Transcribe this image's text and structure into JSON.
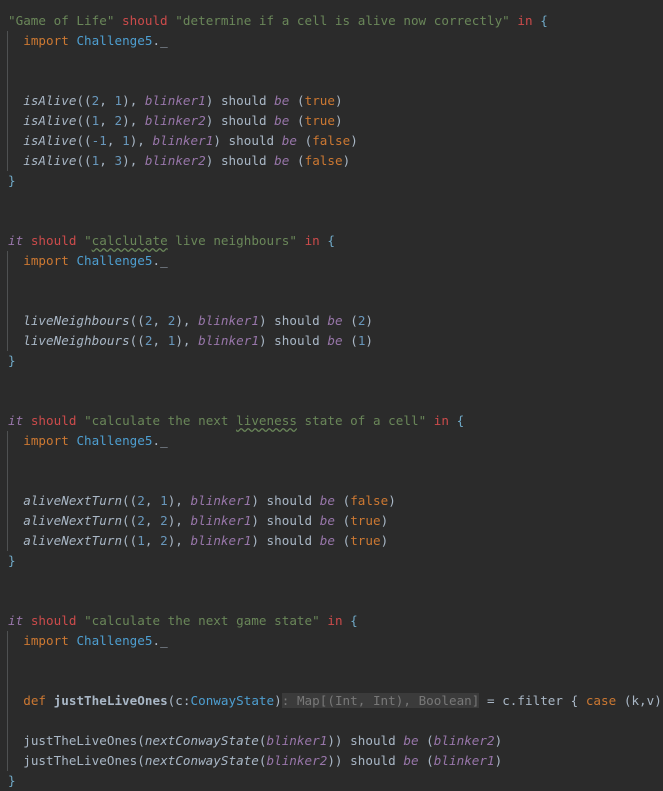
{
  "editor": {
    "language": "scala",
    "theme": "darcula",
    "background_color": "#2b2b2b",
    "default_text_color": "#a9b7c6",
    "colors": {
      "string": "#6a8759",
      "keyword_red": "#cc4b4b",
      "keyword_orange": "#cc7832",
      "identifier_purple": "#9876aa",
      "number": "#6897bb",
      "class_name": "#4e9fd1",
      "type_hint_background": "#3b3b3b",
      "type_hint_text": "#787878",
      "spellcheck_squiggle": "#6a8759",
      "indent_guide": "#4f5152"
    }
  },
  "lines": [
    {
      "id": "line-1",
      "indent": false,
      "tokens": [
        {
          "t": "\"Game of Life\"",
          "c": "str"
        },
        {
          "t": " ",
          "c": "plain"
        },
        {
          "t": "should",
          "c": "kw-red"
        },
        {
          "t": " ",
          "c": "plain"
        },
        {
          "t": "\"determine if a cell is alive now correctly\"",
          "c": "str"
        },
        {
          "t": " ",
          "c": "plain"
        },
        {
          "t": "in",
          "c": "kw-red"
        },
        {
          "t": " ",
          "c": "plain"
        },
        {
          "t": "{",
          "c": "brace-hl"
        }
      ]
    },
    {
      "id": "line-2",
      "indent": true,
      "tokens": [
        {
          "t": "  ",
          "c": "plain"
        },
        {
          "t": "import",
          "c": "kw-or"
        },
        {
          "t": " ",
          "c": "plain"
        },
        {
          "t": "Challenge5",
          "c": "cls"
        },
        {
          "t": "._",
          "c": "plain"
        }
      ]
    },
    {
      "id": "line-3",
      "indent": true,
      "tokens": []
    },
    {
      "id": "line-4",
      "indent": true,
      "tokens": []
    },
    {
      "id": "line-5",
      "indent": true,
      "tokens": [
        {
          "t": "  ",
          "c": "plain"
        },
        {
          "t": "isAlive",
          "c": "ital"
        },
        {
          "t": "((",
          "c": "plain"
        },
        {
          "t": "2",
          "c": "num"
        },
        {
          "t": ", ",
          "c": "plain"
        },
        {
          "t": "1",
          "c": "num"
        },
        {
          "t": "), ",
          "c": "plain"
        },
        {
          "t": "blinker1",
          "c": "purp"
        },
        {
          "t": ") should ",
          "c": "plain"
        },
        {
          "t": "be",
          "c": "purp"
        },
        {
          "t": " (",
          "c": "plain"
        },
        {
          "t": "true",
          "c": "kw-or"
        },
        {
          "t": ")",
          "c": "plain"
        }
      ]
    },
    {
      "id": "line-6",
      "indent": true,
      "tokens": [
        {
          "t": "  ",
          "c": "plain"
        },
        {
          "t": "isAlive",
          "c": "ital"
        },
        {
          "t": "((",
          "c": "plain"
        },
        {
          "t": "1",
          "c": "num"
        },
        {
          "t": ", ",
          "c": "plain"
        },
        {
          "t": "2",
          "c": "num"
        },
        {
          "t": "), ",
          "c": "plain"
        },
        {
          "t": "blinker2",
          "c": "purp"
        },
        {
          "t": ") should ",
          "c": "plain"
        },
        {
          "t": "be",
          "c": "purp"
        },
        {
          "t": " (",
          "c": "plain"
        },
        {
          "t": "true",
          "c": "kw-or"
        },
        {
          "t": ")",
          "c": "plain"
        }
      ]
    },
    {
      "id": "line-7",
      "indent": true,
      "tokens": [
        {
          "t": "  ",
          "c": "plain"
        },
        {
          "t": "isAlive",
          "c": "ital"
        },
        {
          "t": "((",
          "c": "plain"
        },
        {
          "t": "-1",
          "c": "num"
        },
        {
          "t": ", ",
          "c": "plain"
        },
        {
          "t": "1",
          "c": "num"
        },
        {
          "t": "), ",
          "c": "plain"
        },
        {
          "t": "blinker1",
          "c": "purp"
        },
        {
          "t": ") should ",
          "c": "plain"
        },
        {
          "t": "be",
          "c": "purp"
        },
        {
          "t": " (",
          "c": "plain"
        },
        {
          "t": "false",
          "c": "kw-or"
        },
        {
          "t": ")",
          "c": "plain"
        }
      ]
    },
    {
      "id": "line-8",
      "indent": true,
      "tokens": [
        {
          "t": "  ",
          "c": "plain"
        },
        {
          "t": "isAlive",
          "c": "ital"
        },
        {
          "t": "((",
          "c": "plain"
        },
        {
          "t": "1",
          "c": "num"
        },
        {
          "t": ", ",
          "c": "plain"
        },
        {
          "t": "3",
          "c": "num"
        },
        {
          "t": "), ",
          "c": "plain"
        },
        {
          "t": "blinker2",
          "c": "purp"
        },
        {
          "t": ") should ",
          "c": "plain"
        },
        {
          "t": "be",
          "c": "purp"
        },
        {
          "t": " (",
          "c": "plain"
        },
        {
          "t": "false",
          "c": "kw-or"
        },
        {
          "t": ")",
          "c": "plain"
        }
      ]
    },
    {
      "id": "line-9",
      "indent": false,
      "tokens": [
        {
          "t": "}",
          "c": "brace-hl"
        }
      ]
    },
    {
      "id": "line-10",
      "indent": false,
      "tokens": []
    },
    {
      "id": "line-11",
      "indent": false,
      "tokens": []
    },
    {
      "id": "line-12",
      "indent": false,
      "tokens": [
        {
          "t": "it",
          "c": "purp"
        },
        {
          "t": " ",
          "c": "plain"
        },
        {
          "t": "should",
          "c": "kw-red"
        },
        {
          "t": " ",
          "c": "plain"
        },
        {
          "t": "\"",
          "c": "str"
        },
        {
          "t": "calclulate",
          "c": "str typo"
        },
        {
          "t": " live neighbours\"",
          "c": "str"
        },
        {
          "t": " ",
          "c": "plain"
        },
        {
          "t": "in",
          "c": "kw-red"
        },
        {
          "t": " ",
          "c": "plain"
        },
        {
          "t": "{",
          "c": "brace-hl"
        }
      ]
    },
    {
      "id": "line-13",
      "indent": true,
      "tokens": [
        {
          "t": "  ",
          "c": "plain"
        },
        {
          "t": "import",
          "c": "kw-or"
        },
        {
          "t": " ",
          "c": "plain"
        },
        {
          "t": "Challenge5",
          "c": "cls"
        },
        {
          "t": "._",
          "c": "plain"
        }
      ]
    },
    {
      "id": "line-14",
      "indent": true,
      "tokens": []
    },
    {
      "id": "line-15",
      "indent": true,
      "tokens": []
    },
    {
      "id": "line-16",
      "indent": true,
      "tokens": [
        {
          "t": "  ",
          "c": "plain"
        },
        {
          "t": "liveNeighbours",
          "c": "ital"
        },
        {
          "t": "((",
          "c": "plain"
        },
        {
          "t": "2",
          "c": "num"
        },
        {
          "t": ", ",
          "c": "plain"
        },
        {
          "t": "2",
          "c": "num"
        },
        {
          "t": "), ",
          "c": "plain"
        },
        {
          "t": "blinker1",
          "c": "purp"
        },
        {
          "t": ") should ",
          "c": "plain"
        },
        {
          "t": "be",
          "c": "purp"
        },
        {
          "t": " (",
          "c": "plain"
        },
        {
          "t": "2",
          "c": "num"
        },
        {
          "t": ")",
          "c": "plain"
        }
      ]
    },
    {
      "id": "line-17",
      "indent": true,
      "tokens": [
        {
          "t": "  ",
          "c": "plain"
        },
        {
          "t": "liveNeighbours",
          "c": "ital"
        },
        {
          "t": "((",
          "c": "plain"
        },
        {
          "t": "2",
          "c": "num"
        },
        {
          "t": ", ",
          "c": "plain"
        },
        {
          "t": "1",
          "c": "num"
        },
        {
          "t": "), ",
          "c": "plain"
        },
        {
          "t": "blinker1",
          "c": "purp"
        },
        {
          "t": ") should ",
          "c": "plain"
        },
        {
          "t": "be",
          "c": "purp"
        },
        {
          "t": " (",
          "c": "plain"
        },
        {
          "t": "1",
          "c": "num"
        },
        {
          "t": ")",
          "c": "plain"
        }
      ]
    },
    {
      "id": "line-18",
      "indent": false,
      "tokens": [
        {
          "t": "}",
          "c": "brace-hl"
        }
      ]
    },
    {
      "id": "line-19",
      "indent": false,
      "tokens": []
    },
    {
      "id": "line-20",
      "indent": false,
      "tokens": []
    },
    {
      "id": "line-21",
      "indent": false,
      "tokens": [
        {
          "t": "it",
          "c": "purp"
        },
        {
          "t": " ",
          "c": "plain"
        },
        {
          "t": "should",
          "c": "kw-red"
        },
        {
          "t": " ",
          "c": "plain"
        },
        {
          "t": "\"calculate the next ",
          "c": "str"
        },
        {
          "t": "liveness",
          "c": "str typo"
        },
        {
          "t": " state of a cell\"",
          "c": "str"
        },
        {
          "t": " ",
          "c": "plain"
        },
        {
          "t": "in",
          "c": "kw-red"
        },
        {
          "t": " ",
          "c": "plain"
        },
        {
          "t": "{",
          "c": "brace-hl"
        }
      ]
    },
    {
      "id": "line-22",
      "indent": true,
      "tokens": [
        {
          "t": "  ",
          "c": "plain"
        },
        {
          "t": "import",
          "c": "kw-or"
        },
        {
          "t": " ",
          "c": "plain"
        },
        {
          "t": "Challenge5",
          "c": "cls"
        },
        {
          "t": "._",
          "c": "plain"
        }
      ]
    },
    {
      "id": "line-23",
      "indent": true,
      "tokens": []
    },
    {
      "id": "line-24",
      "indent": true,
      "tokens": []
    },
    {
      "id": "line-25",
      "indent": true,
      "tokens": [
        {
          "t": "  ",
          "c": "plain"
        },
        {
          "t": "aliveNextTurn",
          "c": "ital"
        },
        {
          "t": "((",
          "c": "plain"
        },
        {
          "t": "2",
          "c": "num"
        },
        {
          "t": ", ",
          "c": "plain"
        },
        {
          "t": "1",
          "c": "num"
        },
        {
          "t": "), ",
          "c": "plain"
        },
        {
          "t": "blinker1",
          "c": "purp"
        },
        {
          "t": ") should ",
          "c": "plain"
        },
        {
          "t": "be",
          "c": "purp"
        },
        {
          "t": " (",
          "c": "plain"
        },
        {
          "t": "false",
          "c": "kw-or"
        },
        {
          "t": ")",
          "c": "plain"
        }
      ]
    },
    {
      "id": "line-26",
      "indent": true,
      "tokens": [
        {
          "t": "  ",
          "c": "plain"
        },
        {
          "t": "aliveNextTurn",
          "c": "ital"
        },
        {
          "t": "((",
          "c": "plain"
        },
        {
          "t": "2",
          "c": "num"
        },
        {
          "t": ", ",
          "c": "plain"
        },
        {
          "t": "2",
          "c": "num"
        },
        {
          "t": "), ",
          "c": "plain"
        },
        {
          "t": "blinker1",
          "c": "purp"
        },
        {
          "t": ") should ",
          "c": "plain"
        },
        {
          "t": "be",
          "c": "purp"
        },
        {
          "t": " (",
          "c": "plain"
        },
        {
          "t": "true",
          "c": "kw-or"
        },
        {
          "t": ")",
          "c": "plain"
        }
      ]
    },
    {
      "id": "line-27",
      "indent": true,
      "tokens": [
        {
          "t": "  ",
          "c": "plain"
        },
        {
          "t": "aliveNextTurn",
          "c": "ital"
        },
        {
          "t": "((",
          "c": "plain"
        },
        {
          "t": "1",
          "c": "num"
        },
        {
          "t": ", ",
          "c": "plain"
        },
        {
          "t": "2",
          "c": "num"
        },
        {
          "t": "), ",
          "c": "plain"
        },
        {
          "t": "blinker1",
          "c": "purp"
        },
        {
          "t": ") should ",
          "c": "plain"
        },
        {
          "t": "be",
          "c": "purp"
        },
        {
          "t": " (",
          "c": "plain"
        },
        {
          "t": "true",
          "c": "kw-or"
        },
        {
          "t": ")",
          "c": "plain"
        }
      ]
    },
    {
      "id": "line-28",
      "indent": false,
      "tokens": [
        {
          "t": "}",
          "c": "brace-hl"
        }
      ]
    },
    {
      "id": "line-29",
      "indent": false,
      "tokens": []
    },
    {
      "id": "line-30",
      "indent": false,
      "tokens": []
    },
    {
      "id": "line-31",
      "indent": false,
      "tokens": [
        {
          "t": "it",
          "c": "purp"
        },
        {
          "t": " ",
          "c": "plain"
        },
        {
          "t": "should",
          "c": "kw-red"
        },
        {
          "t": " ",
          "c": "plain"
        },
        {
          "t": "\"calculate the next game state\"",
          "c": "str"
        },
        {
          "t": " ",
          "c": "plain"
        },
        {
          "t": "in",
          "c": "kw-red"
        },
        {
          "t": " ",
          "c": "plain"
        },
        {
          "t": "{",
          "c": "brace-hl"
        }
      ]
    },
    {
      "id": "line-32",
      "indent": true,
      "tokens": [
        {
          "t": "  ",
          "c": "plain"
        },
        {
          "t": "import",
          "c": "kw-or"
        },
        {
          "t": " ",
          "c": "plain"
        },
        {
          "t": "Challenge5",
          "c": "cls"
        },
        {
          "t": "._",
          "c": "plain"
        }
      ]
    },
    {
      "id": "line-33",
      "indent": true,
      "tokens": []
    },
    {
      "id": "line-34",
      "indent": true,
      "tokens": []
    },
    {
      "id": "line-35",
      "indent": true,
      "tokens": [
        {
          "t": "  ",
          "c": "plain"
        },
        {
          "t": "def",
          "c": "kw-or"
        },
        {
          "t": " ",
          "c": "plain"
        },
        {
          "t": "justTheLiveOnes",
          "c": "bold"
        },
        {
          "t": "(",
          "c": "plain"
        },
        {
          "t": "c",
          "c": "plain"
        },
        {
          "t": ":",
          "c": "plain"
        },
        {
          "t": "ConwayState",
          "c": "cls"
        },
        {
          "t": ")",
          "c": "plain"
        },
        {
          "t": ": Map[(Int, Int), Boolean]",
          "c": "hint"
        },
        {
          "t": " = c.filter { ",
          "c": "plain"
        },
        {
          "t": "case",
          "c": "kw-or"
        },
        {
          "t": " (k,v) => v }",
          "c": "plain"
        }
      ]
    },
    {
      "id": "line-36",
      "indent": true,
      "tokens": []
    },
    {
      "id": "line-37",
      "indent": true,
      "tokens": [
        {
          "t": "  ",
          "c": "plain"
        },
        {
          "t": "justTheLiveOnes",
          "c": "plain"
        },
        {
          "t": "(",
          "c": "plain"
        },
        {
          "t": "nextConwayState",
          "c": "ital"
        },
        {
          "t": "(",
          "c": "plain"
        },
        {
          "t": "blinker1",
          "c": "purp"
        },
        {
          "t": ")) should ",
          "c": "plain"
        },
        {
          "t": "be",
          "c": "purp"
        },
        {
          "t": " (",
          "c": "plain"
        },
        {
          "t": "blinker2",
          "c": "purp"
        },
        {
          "t": ")",
          "c": "plain"
        }
      ]
    },
    {
      "id": "line-38",
      "indent": true,
      "tokens": [
        {
          "t": "  ",
          "c": "plain"
        },
        {
          "t": "justTheLiveOnes",
          "c": "plain"
        },
        {
          "t": "(",
          "c": "plain"
        },
        {
          "t": "nextConwayState",
          "c": "ital"
        },
        {
          "t": "(",
          "c": "plain"
        },
        {
          "t": "blinker2",
          "c": "purp"
        },
        {
          "t": ")) should ",
          "c": "plain"
        },
        {
          "t": "be",
          "c": "purp"
        },
        {
          "t": " (",
          "c": "plain"
        },
        {
          "t": "blinker1",
          "c": "purp"
        },
        {
          "t": ")",
          "c": "plain"
        }
      ]
    },
    {
      "id": "line-39",
      "indent": false,
      "tokens": [
        {
          "t": "}",
          "c": "brace-hl"
        }
      ]
    }
  ]
}
